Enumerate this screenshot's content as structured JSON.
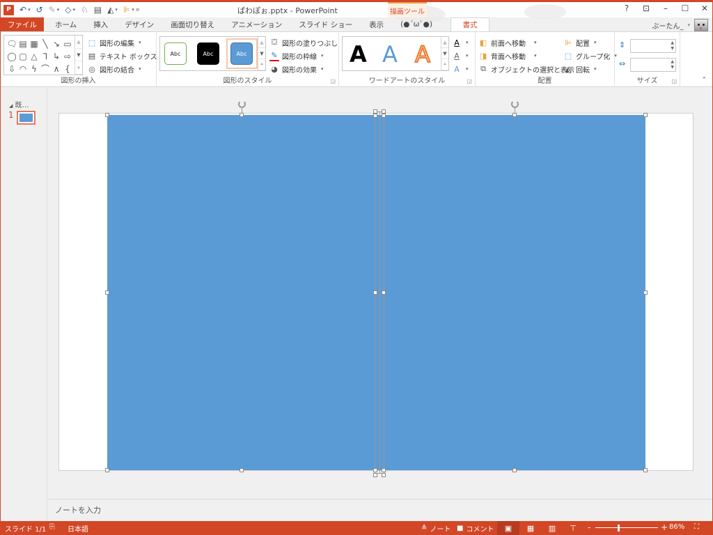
{
  "titlebar": {
    "document_title": "ぱわぽぉ.pptx - PowerPoint",
    "contextual_tab_group": "描画ツール",
    "qat_icons": [
      "powerpoint-logo",
      "undo-icon",
      "redo-icon",
      "format-painter-icon",
      "shape-icon",
      "animation-icon",
      "textbox-icon",
      "rotate-icon",
      "align-icon",
      "customize-icon"
    ],
    "window_buttons": {
      "help": "?",
      "ribbon_display": "⊡",
      "minimize": "–",
      "maximize": "☐",
      "close": "✕"
    }
  },
  "tabs": [
    {
      "label": "ファイル",
      "type": "file"
    },
    {
      "label": "ホーム"
    },
    {
      "label": "挿入"
    },
    {
      "label": "デザイン"
    },
    {
      "label": "画面切り替え"
    },
    {
      "label": "アニメーション"
    },
    {
      "label": "スライド ショー"
    },
    {
      "label": "表示"
    },
    {
      "label": "(●´ω`●)"
    },
    {
      "label": "書式",
      "active": true
    }
  ],
  "user": {
    "name": "ぶーたん_"
  },
  "ribbon": {
    "insert_shapes": {
      "label": "図形の挿入",
      "shapes": [
        "🗨",
        "▤",
        "▦",
        "╲",
        "↘",
        "▭",
        "◯",
        "▢",
        "△",
        "⅂",
        "↳",
        "⇨",
        "⇩",
        "◠",
        "ϟ",
        "⌒",
        "∧",
        "{"
      ],
      "edit_shape": "図形の編集",
      "text_box": "テキスト ボックス",
      "merge_shapes": "図形の結合"
    },
    "shape_styles": {
      "label": "図形のスタイル",
      "thumb_text": "Abc",
      "shape_fill": "図形の塗りつぶし",
      "shape_outline": "図形の枠線",
      "shape_effects": "図形の効果"
    },
    "wordart_styles": {
      "label": "ワードアートのスタイル",
      "letter": "A"
    },
    "arrange": {
      "label": "配置",
      "bring_forward": "前面へ移動",
      "send_backward": "背面へ移動",
      "selection_pane": "オブジェクトの選択と表示",
      "align": "配置",
      "group": "グループ化",
      "rotate": "回転"
    },
    "size": {
      "label": "サイズ",
      "height_value": "",
      "width_value": ""
    }
  },
  "left_pane": {
    "section_title": "既…",
    "slide_number": "1"
  },
  "notes": {
    "placeholder": "ノートを入力"
  },
  "status": {
    "slide_indicator": "スライド 1/1",
    "language": "日本語",
    "notes_label": "ノート",
    "comments_label": "コメント",
    "zoom_level": "86%",
    "zoom_percent": 86
  },
  "colors": {
    "accent": "#d24726",
    "shape_fill": "#5b9bd5",
    "contextual_tab": "#f39c40"
  }
}
